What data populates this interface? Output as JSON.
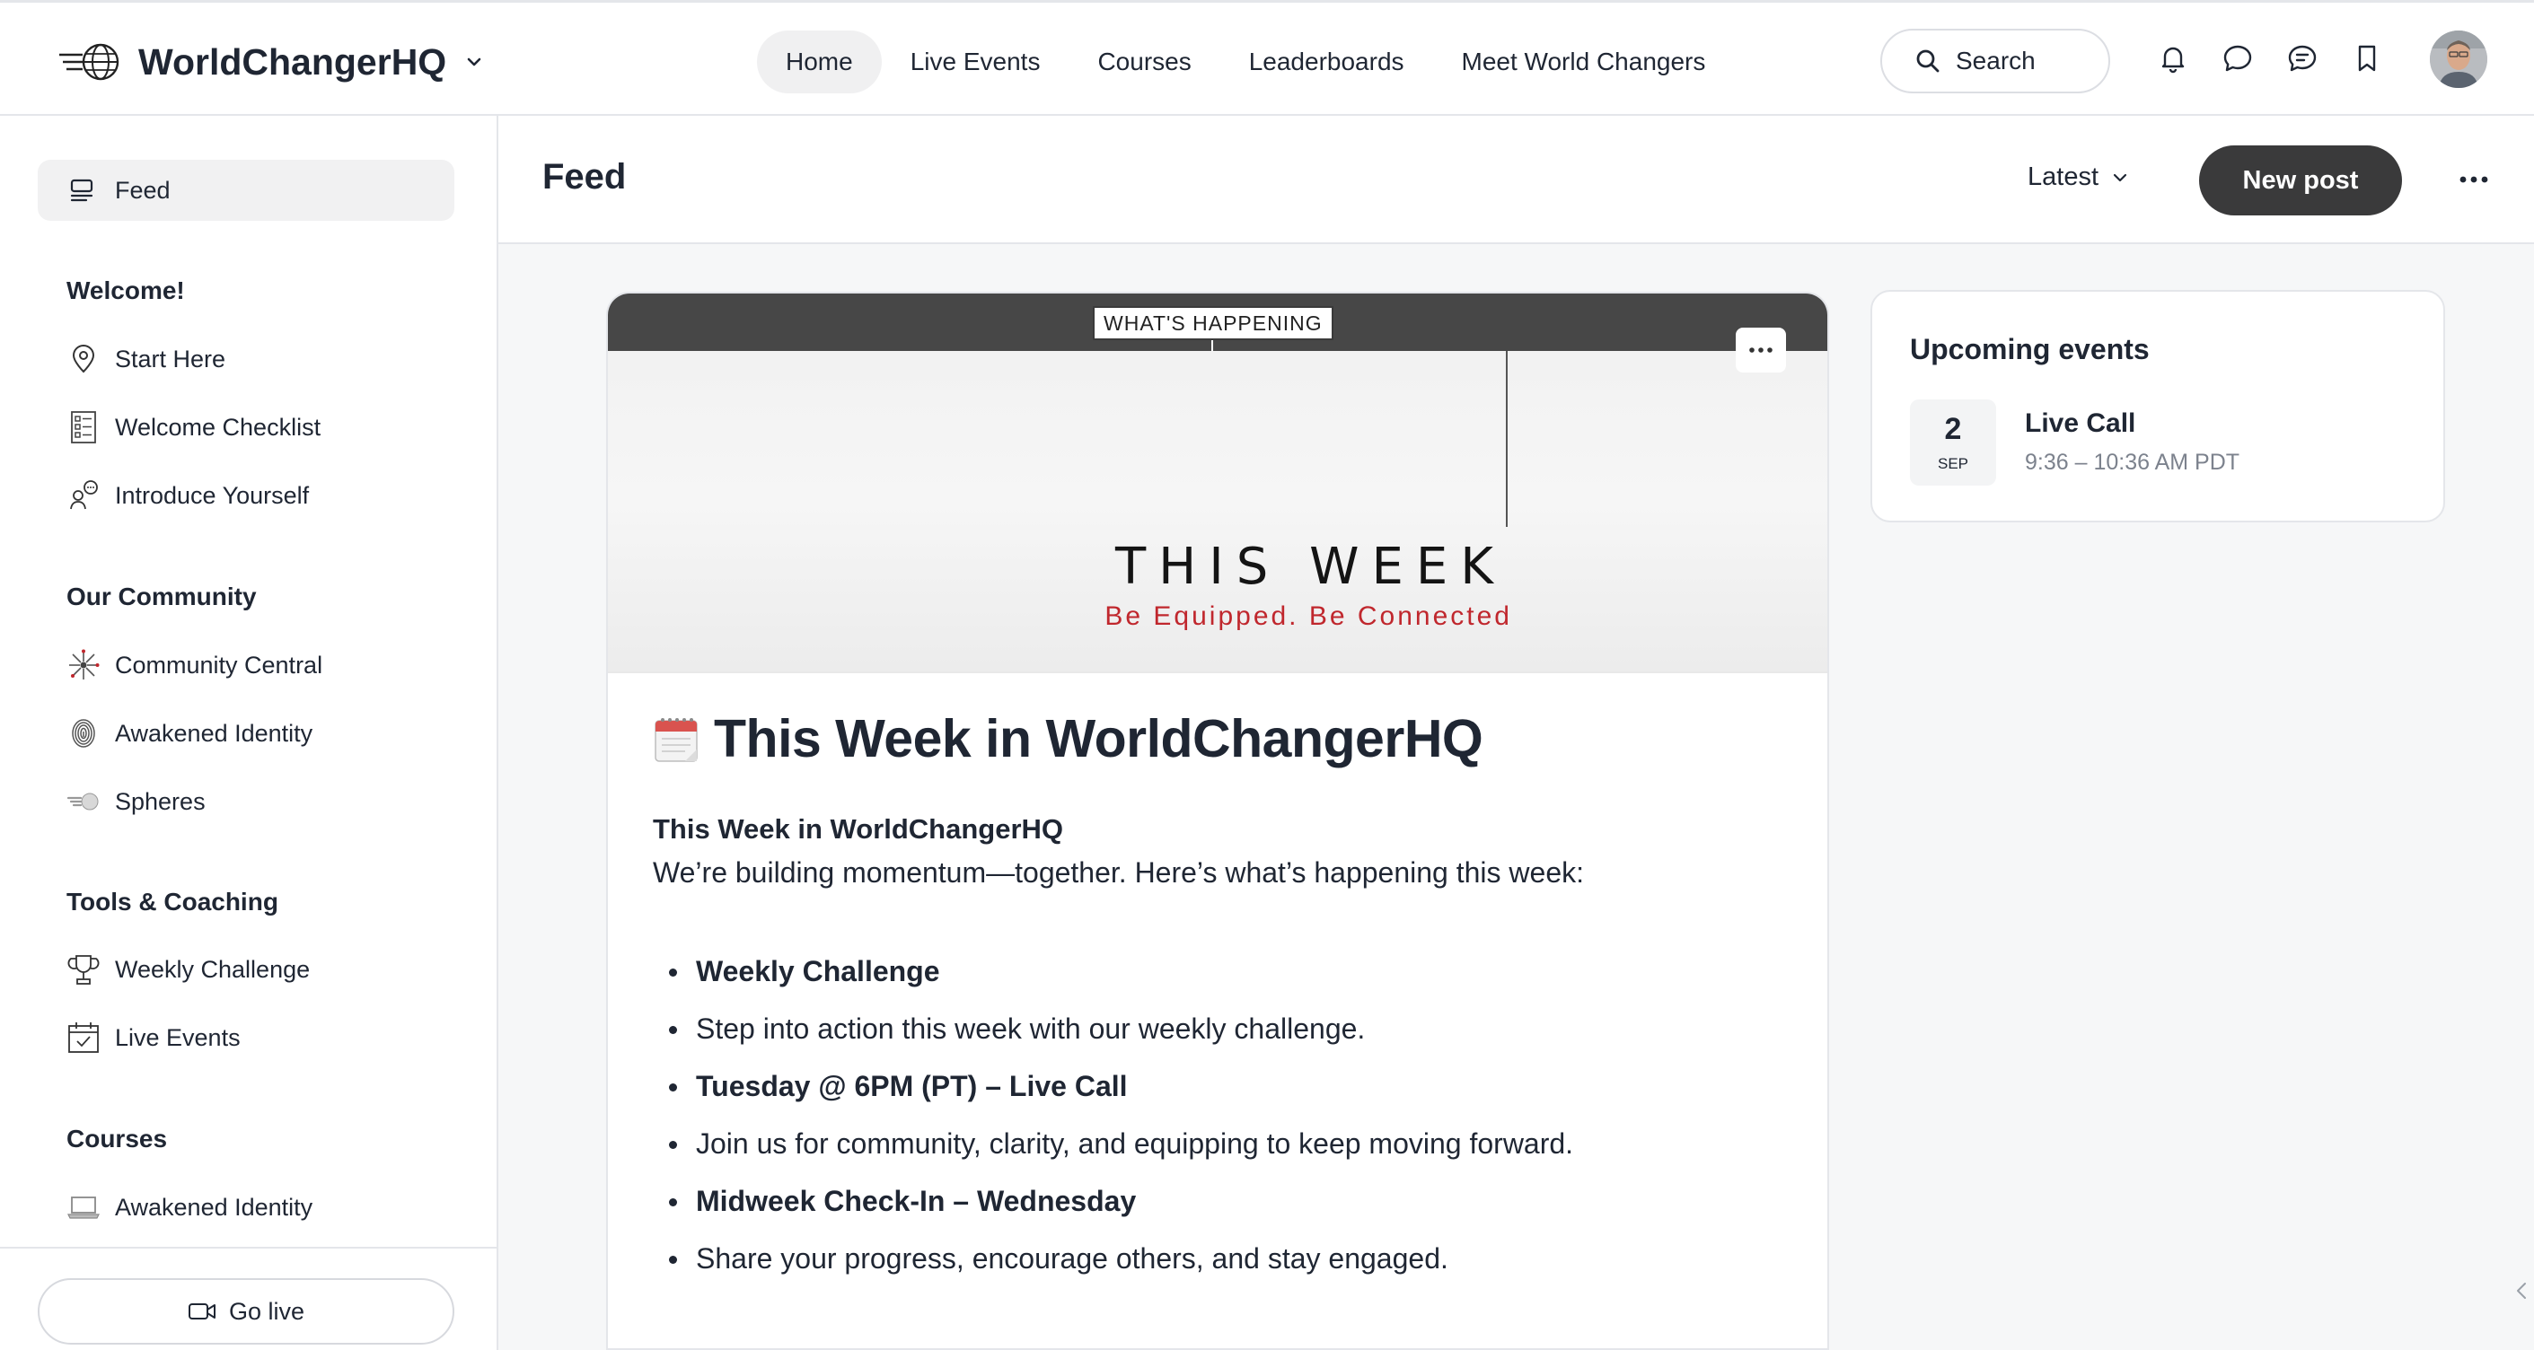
{
  "header": {
    "brand": "WorldChangerHQ",
    "nav": [
      "Home",
      "Live Events",
      "Courses",
      "Leaderboards",
      "Meet World Changers"
    ],
    "search_label": "Search"
  },
  "sidebar": {
    "feed_label": "Feed",
    "sections": [
      {
        "heading": "Welcome!",
        "items": [
          "Start Here",
          "Welcome Checklist",
          "Introduce Yourself"
        ]
      },
      {
        "heading": "Our Community",
        "items": [
          "Community Central",
          "Awakened Identity",
          "Spheres"
        ]
      },
      {
        "heading": "Tools & Coaching",
        "items": [
          "Weekly Challenge",
          "Live Events"
        ]
      },
      {
        "heading": "Courses",
        "items": [
          "Awakened Identity"
        ]
      }
    ],
    "go_live_label": "Go live"
  },
  "main": {
    "title": "Feed",
    "sort_label": "Latest",
    "new_post_label": "New post"
  },
  "post": {
    "banner_tag": "WHAT'S HAPPENING",
    "banner_title": "THIS WEEK",
    "banner_subtitle": "Be Equipped. Be Connected",
    "title": "This Week in WorldChangerHQ",
    "subtitle": "This Week in WorldChangerHQ",
    "intro": "We’re building momentum—together. Here’s what’s happening this week:",
    "list": [
      "Weekly Challenge",
      "Step into action this week with our weekly challenge.",
      "Tuesday @ 6PM (PT) – Live Call",
      "Join us for community, clarity, and equipping to keep moving forward.",
      "Midweek Check-In – Wednesday",
      "Share your progress, encourage others, and stay engaged."
    ]
  },
  "events": {
    "title": "Upcoming events",
    "items": [
      {
        "day": "2",
        "month": "SEP",
        "name": "Live Call",
        "time": "9:36 – 10:36 AM PDT"
      }
    ]
  },
  "colors": {
    "primary_button": "#3a3a3b",
    "accent_red": "#c0272d",
    "text": "#1f2633",
    "muted_text": "#7c828d"
  }
}
